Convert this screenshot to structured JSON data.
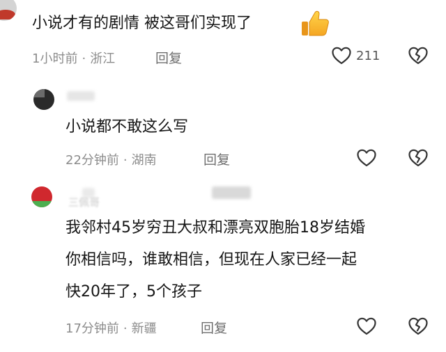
{
  "comments": [
    {
      "text": "小说才有的剧情 被这哥们实现了",
      "emoji": "thumbs-up-icon",
      "time": "1小时前",
      "location": "浙江",
      "reply_label": "回复",
      "like_count": "211"
    },
    {
      "text": "小说都不敢这么写",
      "time": "22分钟前",
      "location": "湖南",
      "reply_label": "回复",
      "like_count": ""
    },
    {
      "username_partial": "三佩哥",
      "lines": [
        "我邻村45岁穷丑大叔和漂亮双胞胎18岁结婚",
        "你相信吗，谁敢相信，但现在人家已经一起",
        "快20年了，5个孩子"
      ],
      "time": "17分钟前",
      "location": "新疆",
      "reply_label": "回复",
      "like_count": ""
    }
  ],
  "separator": "·",
  "colors": {
    "text": "#151515",
    "meta": "#8c8c8c",
    "icon": "#333333"
  }
}
